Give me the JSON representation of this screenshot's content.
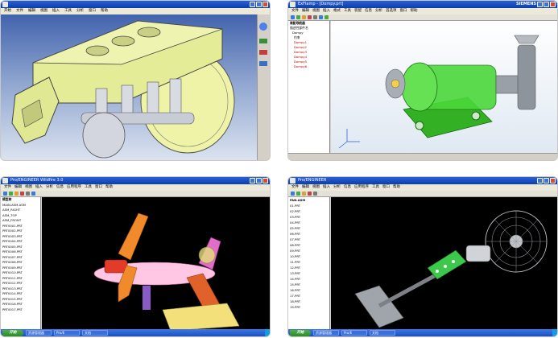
{
  "panels": [
    {
      "title": "",
      "menu": [
        "开始",
        "文件",
        "编辑",
        "视图",
        "插入",
        "工具",
        "分析",
        "窗口",
        "帮助"
      ]
    },
    {
      "title": "ExFlamp - [Dompy.prt]",
      "menu": [
        "文件",
        "编辑",
        "视图",
        "插入",
        "格式",
        "工具",
        "装配",
        "信息",
        "分析",
        "首选项",
        "窗口",
        "帮助"
      ],
      "tree_header": "装配导航器",
      "tree_items": [
        "描述性部件名",
        "Dompy",
        "约束",
        "Dompy1",
        "Dompy2",
        "Dompy3",
        "Dompy4",
        "Dompy5",
        "Dompy6"
      ],
      "brand": "SIEMENS"
    },
    {
      "title": "Pro/ENGINEER Wildfire 3.0",
      "menu": [
        "文件",
        "编辑",
        "视图",
        "插入",
        "分析",
        "信息",
        "应用程序",
        "工具",
        "窗口",
        "帮助"
      ],
      "tree_items": [
        "模型树",
        "MAIN-ASM.ASM",
        "ASM_RIGHT",
        "ASM_TOP",
        "ASM_FRONT",
        "PRT0001.PRT",
        "PRT0002.PRT",
        "PRT0003.PRT",
        "PRT0004.PRT",
        "PRT0005.PRT",
        "PRT0006.PRT",
        "PRT0007.PRT",
        "PRT0008.PRT",
        "PRT0009.PRT",
        "PRT0010.PRT",
        "PRT0011.PRT",
        "PRT0012.PRT",
        "PRT0013.PRT",
        "PRT0014.PRT",
        "PRT0015.PRT",
        "PRT0016.PRT",
        "PRT0017.PRT"
      ],
      "taskbar": {
        "start": "开始",
        "items": [
          "资源管理器",
          "Pro/E",
          "文档"
        ],
        "clock": ""
      }
    },
    {
      "title": "Pro/ENGINEER",
      "menu": [
        "文件",
        "编辑",
        "视图",
        "插入",
        "分析",
        "信息",
        "应用程序",
        "工具",
        "窗口",
        "帮助"
      ],
      "tree_items": [
        "FAN.ASM",
        "01.PRT",
        "02.PRT",
        "03.PRT",
        "04.PRT",
        "05.PRT",
        "06.PRT",
        "07.PRT",
        "08.PRT",
        "09.PRT",
        "10.PRT",
        "11.PRT",
        "12.PRT",
        "13.PRT",
        "14.PRT",
        "15.PRT",
        "16.PRT",
        "17.PRT",
        "18.PRT",
        "19.PRT"
      ],
      "taskbar": {
        "start": "开始",
        "items": [
          "资源管理器",
          "Pro/E",
          "文档"
        ],
        "clock": ""
      }
    }
  ],
  "colors": {
    "catia_bg_top": "#3d5fa8",
    "catia_bg_bottom": "#dfe6f2",
    "part_yellow": "#e8ef9a",
    "part_green": "#3ecb2a",
    "proe_bg": "#000000"
  }
}
